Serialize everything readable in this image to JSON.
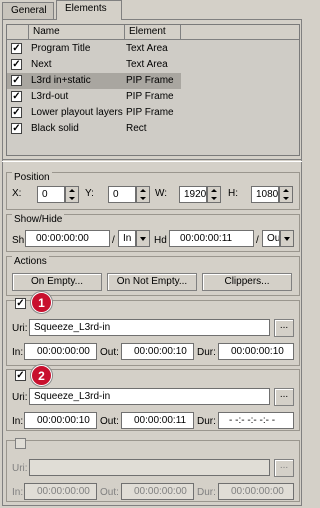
{
  "tabs": [
    {
      "label": "General"
    },
    {
      "label": "Elements"
    }
  ],
  "list": {
    "headers": {
      "name": "Name",
      "element": "Element"
    },
    "rows": [
      {
        "name": "Program Title",
        "element": "Text Area",
        "checked": true
      },
      {
        "name": "Next",
        "element": "Text Area",
        "checked": true
      },
      {
        "name": "L3rd in+static",
        "element": "PIP Frame",
        "checked": true
      },
      {
        "name": "L3rd-out",
        "element": "PIP Frame",
        "checked": true
      },
      {
        "name": "Lower playout  layers",
        "element": "PIP Frame",
        "checked": true
      },
      {
        "name": "Black solid",
        "element": "Rect",
        "checked": true
      }
    ],
    "selected_index": 2
  },
  "position": {
    "title": "Position",
    "x_label": "X:",
    "x_value": "0",
    "y_label": "Y:",
    "y_value": "0",
    "w_label": "W:",
    "w_value": "1920",
    "h_label": "H:",
    "h_value": "1080"
  },
  "showhide": {
    "title": "Show/Hide",
    "sh_label": "Sh",
    "sh_value": "00:00:00:00",
    "sh_mode": "In",
    "hd_label": "Hd",
    "hd_value": "00:00:00:11",
    "hd_mode": "Ou"
  },
  "actions": {
    "title": "Actions",
    "on_empty": "On Empty...",
    "on_not_empty": "On Not Empty...",
    "clippers": "Clippers..."
  },
  "clips": [
    {
      "badge": "1",
      "checked": true,
      "uri_label": "Uri:",
      "uri": "Squeeze_L3rd-in",
      "browse": "...",
      "in_label": "In:",
      "in": "00:00:00:00",
      "out_label": "Out:",
      "out": "00:00:00:10",
      "dur_label": "Dur:",
      "dur": "00:00:00:10"
    },
    {
      "badge": "2",
      "checked": true,
      "uri_label": "Uri:",
      "uri": "Squeeze_L3rd-in",
      "browse": "...",
      "in_label": "In:",
      "in": "00:00:00:10",
      "out_label": "Out:",
      "out": "00:00:00:11",
      "dur_label": "Dur:",
      "dur": "- -:- -:- -:- -"
    },
    {
      "badge": "",
      "checked": false,
      "uri_label": "Uri:",
      "uri": "",
      "browse": "...",
      "in_label": "In:",
      "in": "00:00:00:00",
      "out_label": "Out:",
      "out": "00:00:00:00",
      "dur_label": "Dur:",
      "dur": "00:00:00:00"
    }
  ],
  "colors": {
    "badge": "#c8102e",
    "selected_row": "#a9a6a0",
    "background": "#d4d0c8"
  }
}
